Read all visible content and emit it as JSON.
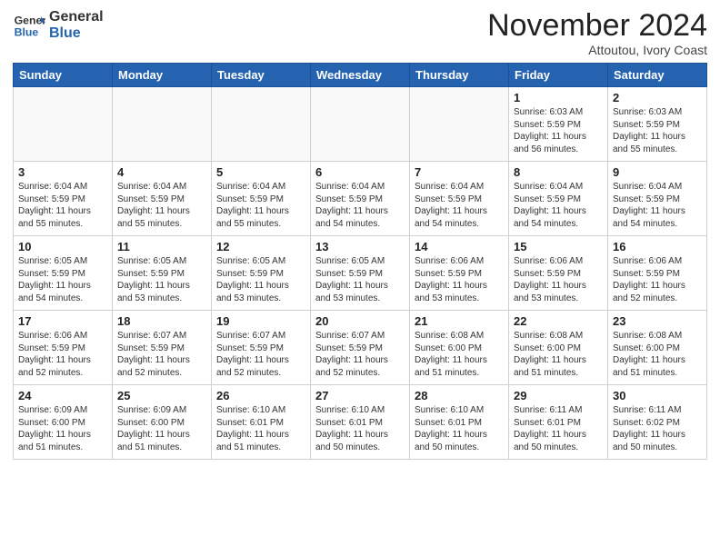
{
  "header": {
    "logo_general": "General",
    "logo_blue": "Blue",
    "month_title": "November 2024",
    "subtitle": "Attoutou, Ivory Coast"
  },
  "weekdays": [
    "Sunday",
    "Monday",
    "Tuesday",
    "Wednesday",
    "Thursday",
    "Friday",
    "Saturday"
  ],
  "weeks": [
    [
      {
        "day": "",
        "info": ""
      },
      {
        "day": "",
        "info": ""
      },
      {
        "day": "",
        "info": ""
      },
      {
        "day": "",
        "info": ""
      },
      {
        "day": "",
        "info": ""
      },
      {
        "day": "1",
        "info": "Sunrise: 6:03 AM\nSunset: 5:59 PM\nDaylight: 11 hours\nand 56 minutes."
      },
      {
        "day": "2",
        "info": "Sunrise: 6:03 AM\nSunset: 5:59 PM\nDaylight: 11 hours\nand 55 minutes."
      }
    ],
    [
      {
        "day": "3",
        "info": "Sunrise: 6:04 AM\nSunset: 5:59 PM\nDaylight: 11 hours\nand 55 minutes."
      },
      {
        "day": "4",
        "info": "Sunrise: 6:04 AM\nSunset: 5:59 PM\nDaylight: 11 hours\nand 55 minutes."
      },
      {
        "day": "5",
        "info": "Sunrise: 6:04 AM\nSunset: 5:59 PM\nDaylight: 11 hours\nand 55 minutes."
      },
      {
        "day": "6",
        "info": "Sunrise: 6:04 AM\nSunset: 5:59 PM\nDaylight: 11 hours\nand 54 minutes."
      },
      {
        "day": "7",
        "info": "Sunrise: 6:04 AM\nSunset: 5:59 PM\nDaylight: 11 hours\nand 54 minutes."
      },
      {
        "day": "8",
        "info": "Sunrise: 6:04 AM\nSunset: 5:59 PM\nDaylight: 11 hours\nand 54 minutes."
      },
      {
        "day": "9",
        "info": "Sunrise: 6:04 AM\nSunset: 5:59 PM\nDaylight: 11 hours\nand 54 minutes."
      }
    ],
    [
      {
        "day": "10",
        "info": "Sunrise: 6:05 AM\nSunset: 5:59 PM\nDaylight: 11 hours\nand 54 minutes."
      },
      {
        "day": "11",
        "info": "Sunrise: 6:05 AM\nSunset: 5:59 PM\nDaylight: 11 hours\nand 53 minutes."
      },
      {
        "day": "12",
        "info": "Sunrise: 6:05 AM\nSunset: 5:59 PM\nDaylight: 11 hours\nand 53 minutes."
      },
      {
        "day": "13",
        "info": "Sunrise: 6:05 AM\nSunset: 5:59 PM\nDaylight: 11 hours\nand 53 minutes."
      },
      {
        "day": "14",
        "info": "Sunrise: 6:06 AM\nSunset: 5:59 PM\nDaylight: 11 hours\nand 53 minutes."
      },
      {
        "day": "15",
        "info": "Sunrise: 6:06 AM\nSunset: 5:59 PM\nDaylight: 11 hours\nand 53 minutes."
      },
      {
        "day": "16",
        "info": "Sunrise: 6:06 AM\nSunset: 5:59 PM\nDaylight: 11 hours\nand 52 minutes."
      }
    ],
    [
      {
        "day": "17",
        "info": "Sunrise: 6:06 AM\nSunset: 5:59 PM\nDaylight: 11 hours\nand 52 minutes."
      },
      {
        "day": "18",
        "info": "Sunrise: 6:07 AM\nSunset: 5:59 PM\nDaylight: 11 hours\nand 52 minutes."
      },
      {
        "day": "19",
        "info": "Sunrise: 6:07 AM\nSunset: 5:59 PM\nDaylight: 11 hours\nand 52 minutes."
      },
      {
        "day": "20",
        "info": "Sunrise: 6:07 AM\nSunset: 5:59 PM\nDaylight: 11 hours\nand 52 minutes."
      },
      {
        "day": "21",
        "info": "Sunrise: 6:08 AM\nSunset: 6:00 PM\nDaylight: 11 hours\nand 51 minutes."
      },
      {
        "day": "22",
        "info": "Sunrise: 6:08 AM\nSunset: 6:00 PM\nDaylight: 11 hours\nand 51 minutes."
      },
      {
        "day": "23",
        "info": "Sunrise: 6:08 AM\nSunset: 6:00 PM\nDaylight: 11 hours\nand 51 minutes."
      }
    ],
    [
      {
        "day": "24",
        "info": "Sunrise: 6:09 AM\nSunset: 6:00 PM\nDaylight: 11 hours\nand 51 minutes."
      },
      {
        "day": "25",
        "info": "Sunrise: 6:09 AM\nSunset: 6:00 PM\nDaylight: 11 hours\nand 51 minutes."
      },
      {
        "day": "26",
        "info": "Sunrise: 6:10 AM\nSunset: 6:01 PM\nDaylight: 11 hours\nand 51 minutes."
      },
      {
        "day": "27",
        "info": "Sunrise: 6:10 AM\nSunset: 6:01 PM\nDaylight: 11 hours\nand 50 minutes."
      },
      {
        "day": "28",
        "info": "Sunrise: 6:10 AM\nSunset: 6:01 PM\nDaylight: 11 hours\nand 50 minutes."
      },
      {
        "day": "29",
        "info": "Sunrise: 6:11 AM\nSunset: 6:01 PM\nDaylight: 11 hours\nand 50 minutes."
      },
      {
        "day": "30",
        "info": "Sunrise: 6:11 AM\nSunset: 6:02 PM\nDaylight: 11 hours\nand 50 minutes."
      }
    ]
  ]
}
